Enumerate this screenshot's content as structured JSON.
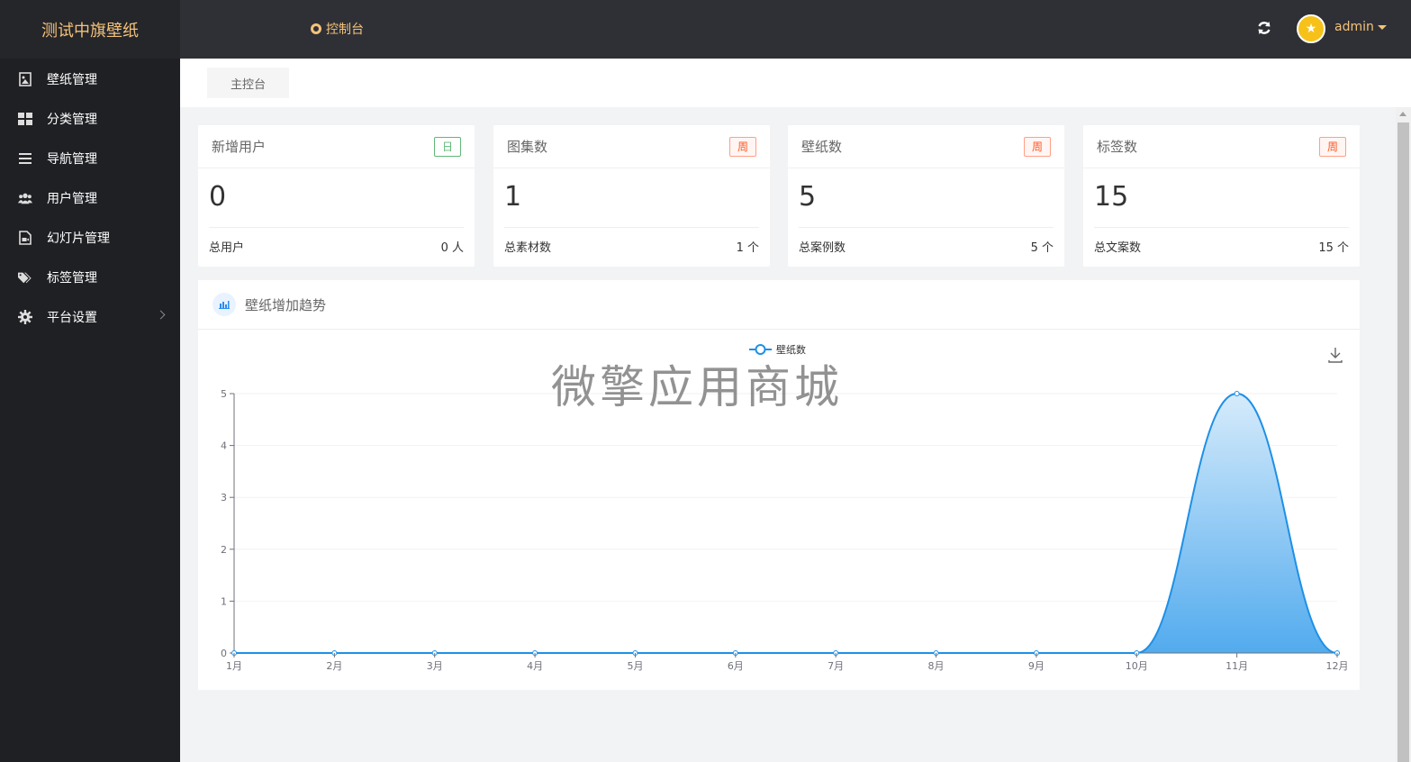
{
  "app": {
    "title": "测试中旗壁纸",
    "console_label": "控制台",
    "user_name": "admin"
  },
  "sidebar": {
    "items": [
      {
        "label": "壁纸管理",
        "icon": "image-icon"
      },
      {
        "label": "分类管理",
        "icon": "grid-icon"
      },
      {
        "label": "导航管理",
        "icon": "menu-icon"
      },
      {
        "label": "用户管理",
        "icon": "users-icon"
      },
      {
        "label": "幻灯片管理",
        "icon": "slides-icon"
      },
      {
        "label": "标签管理",
        "icon": "tags-icon"
      },
      {
        "label": "平台设置",
        "icon": "gear-icon"
      }
    ]
  },
  "breadcrumb": {
    "label": "主控台"
  },
  "stats": [
    {
      "title": "新增用户",
      "badge": "日",
      "badge_color": "#5fb878",
      "value": "0",
      "foot_label": "总用户",
      "foot_value": "0 人"
    },
    {
      "title": "图集数",
      "badge": "周",
      "badge_color": "#ff5722",
      "value": "1",
      "foot_label": "总素材数",
      "foot_value": "1 个"
    },
    {
      "title": "壁纸数",
      "badge": "周",
      "badge_color": "#ff5722",
      "value": "5",
      "foot_label": "总案例数",
      "foot_value": "5 个"
    },
    {
      "title": "标签数",
      "badge": "周",
      "badge_color": "#ff5722",
      "value": "15",
      "foot_label": "总文案数",
      "foot_value": "15 个"
    }
  ],
  "panel": {
    "title": "壁纸增加趋势"
  },
  "watermark": "微擎应用商城",
  "chart_data": {
    "type": "area",
    "categories": [
      "1月",
      "2月",
      "3月",
      "4月",
      "5月",
      "6月",
      "7月",
      "8月",
      "9月",
      "10月",
      "11月",
      "12月"
    ],
    "series": [
      {
        "name": "壁纸数",
        "values": [
          0,
          0,
          0,
          0,
          0,
          0,
          0,
          0,
          0,
          0,
          5,
          0
        ],
        "color": "#1e90e6"
      }
    ],
    "yticks": [
      0,
      1,
      2,
      3,
      4,
      5
    ],
    "ylim": [
      0,
      5
    ],
    "legend": "top-center",
    "grid": true,
    "smooth": true
  },
  "colors": {
    "accent": "#f4c27a",
    "topbar": "#2f3035",
    "sidebar": "#1f2024",
    "line": "#1e90e6"
  }
}
